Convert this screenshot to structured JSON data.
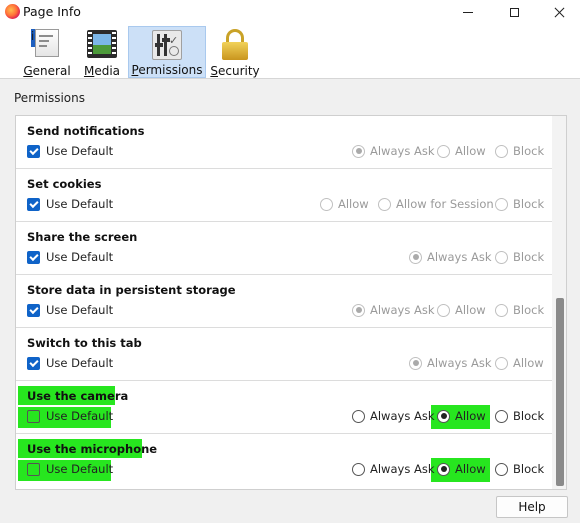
{
  "window": {
    "title": "Page Info"
  },
  "tabs": [
    {
      "label": "General",
      "underline": "G",
      "rest": "eneral",
      "icon": "info-icon",
      "active": false
    },
    {
      "label": "Media",
      "underline": "M",
      "rest": "edia",
      "icon": "film-icon",
      "active": false
    },
    {
      "label": "Permissions",
      "underline": "P",
      "rest": "ermissions",
      "icon": "sliders-icon",
      "active": true
    },
    {
      "label": "Security",
      "underline": "S",
      "rest": "ecurity",
      "icon": "padlock-icon",
      "active": false
    }
  ],
  "section_label": "Permissions",
  "permissions": [
    {
      "title": "Send notifications",
      "use_default": true,
      "options": [
        {
          "label": "Always Ask",
          "selected": true
        },
        {
          "label": "Allow",
          "selected": false
        },
        {
          "label": "Block",
          "selected": false
        }
      ]
    },
    {
      "title": "Set cookies",
      "use_default": true,
      "options": [
        {
          "label": "Allow",
          "selected": false
        },
        {
          "label": "Allow for Session",
          "selected": false
        },
        {
          "label": "Block",
          "selected": false
        }
      ]
    },
    {
      "title": "Share the screen",
      "use_default": true,
      "options": [
        {
          "label": "Always Ask",
          "selected": true
        },
        {
          "label": "Block",
          "selected": false
        }
      ]
    },
    {
      "title": "Store data in persistent storage",
      "use_default": true,
      "options": [
        {
          "label": "Always Ask",
          "selected": true
        },
        {
          "label": "Allow",
          "selected": false
        },
        {
          "label": "Block",
          "selected": false
        }
      ]
    },
    {
      "title": "Switch to this tab",
      "use_default": true,
      "options": [
        {
          "label": "Always Ask",
          "selected": true
        },
        {
          "label": "Allow",
          "selected": false
        }
      ]
    },
    {
      "title": "Use the camera",
      "use_default": false,
      "highlighted": true,
      "options": [
        {
          "label": "Always Ask",
          "selected": false
        },
        {
          "label": "Allow",
          "selected": true
        },
        {
          "label": "Block",
          "selected": false
        }
      ]
    },
    {
      "title": "Use the microphone",
      "use_default": false,
      "highlighted": true,
      "options": [
        {
          "label": "Always Ask",
          "selected": false
        },
        {
          "label": "Allow",
          "selected": true
        },
        {
          "label": "Block",
          "selected": false
        }
      ]
    }
  ],
  "use_default_label": "Use Default",
  "help_button": "Help",
  "colors": {
    "highlight": "#27e61f",
    "checkbox_checked": "#0f63c8",
    "active_tab": "#cce0f7"
  }
}
